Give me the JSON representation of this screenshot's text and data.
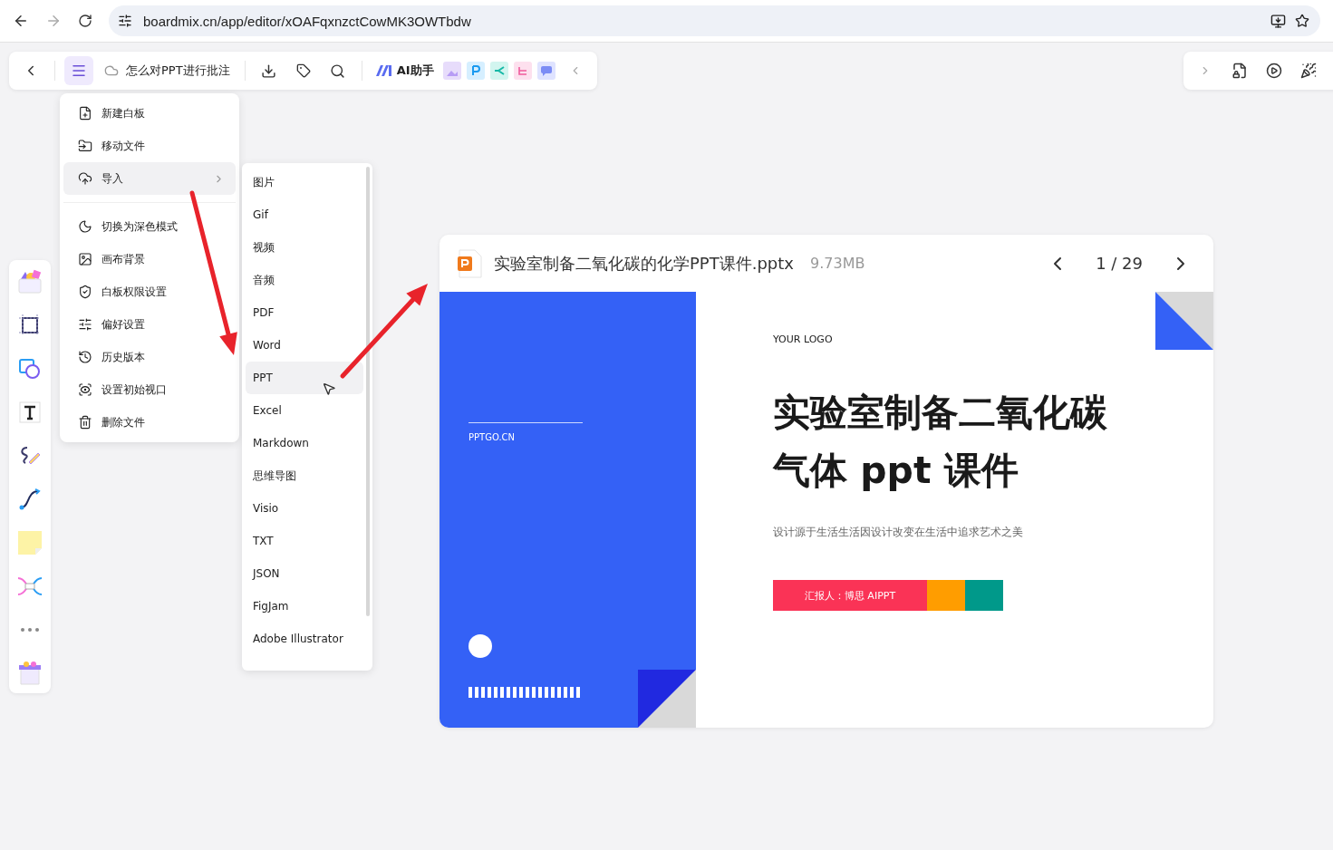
{
  "browser": {
    "url": "boardmix.cn/app/editor/xOAFqxnzctCowMK3OWTbdw"
  },
  "toolbar": {
    "title": "怎么对PPT进行批注",
    "ai_label": "AI助手"
  },
  "menu": {
    "groups": [
      [
        {
          "label": "新建白板",
          "highlighted": false,
          "has_submenu": false
        },
        {
          "label": "移动文件",
          "highlighted": false,
          "has_submenu": false
        },
        {
          "label": "导入",
          "highlighted": true,
          "has_submenu": true
        }
      ],
      [
        {
          "label": "切换为深色模式",
          "highlighted": false,
          "has_submenu": false
        },
        {
          "label": "画布背景",
          "highlighted": false,
          "has_submenu": false
        },
        {
          "label": "白板权限设置",
          "highlighted": false,
          "has_submenu": false
        },
        {
          "label": "偏好设置",
          "highlighted": false,
          "has_submenu": false
        },
        {
          "label": "历史版本",
          "highlighted": false,
          "has_submenu": false
        },
        {
          "label": "设置初始视口",
          "highlighted": false,
          "has_submenu": false
        },
        {
          "label": "删除文件",
          "highlighted": false,
          "has_submenu": false
        }
      ]
    ]
  },
  "submenu": {
    "items": [
      {
        "label": "图片",
        "selected": false
      },
      {
        "label": "Gif",
        "selected": false
      },
      {
        "label": "视频",
        "selected": false
      },
      {
        "label": "音频",
        "selected": false
      },
      {
        "label": "PDF",
        "selected": false
      },
      {
        "label": "Word",
        "selected": false
      },
      {
        "label": "PPT",
        "selected": true
      },
      {
        "label": "Excel",
        "selected": false
      },
      {
        "label": "Markdown",
        "selected": false
      },
      {
        "label": "思维导图",
        "selected": false
      },
      {
        "label": "Visio",
        "selected": false
      },
      {
        "label": "TXT",
        "selected": false
      },
      {
        "label": "JSON",
        "selected": false
      },
      {
        "label": "FigJam",
        "selected": false
      },
      {
        "label": "Adobe Illustrator",
        "selected": false
      }
    ]
  },
  "preview": {
    "file_name": "实验室制备二氧化碳的化学PPT课件.pptx",
    "size": "9.73MB",
    "page": "1 / 29",
    "slide": {
      "site": "PPTGO.CN",
      "logo": "YOUR LOGO",
      "title_lines": [
        "实验室制备二氧化碳",
        "气体 ppt 课件"
      ],
      "subtitle": "设计源于生活生活因设计改变在生活中追求艺术之美",
      "reporter": "汇报人：博思 AIPPT"
    }
  }
}
